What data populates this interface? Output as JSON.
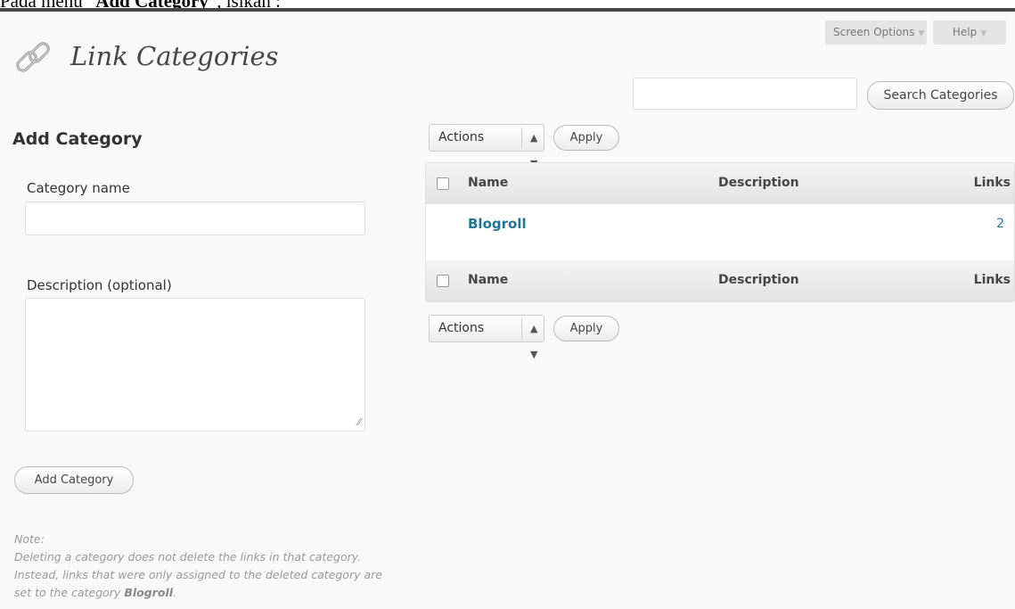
{
  "caption": {
    "prefix": "Pada menu “",
    "bold": "Add Category",
    "suffix": "”, isikan :"
  },
  "header": {
    "screen_options": "Screen Options",
    "help": "Help",
    "title": "Link Categories",
    "icon": "link-icon"
  },
  "search": {
    "input_value": "",
    "button_label": "Search Categories"
  },
  "add_form": {
    "heading": "Add Category",
    "name_label": "Category name",
    "name_value": "",
    "description_label": "Description (optional)",
    "description_value": "",
    "submit_label": "Add Category"
  },
  "note": {
    "title": "Note:",
    "text_before": "Deleting a category does not delete the links in that category. Instead, links that were only assigned to the deleted category are set to the category ",
    "bold": "Blogroll",
    "text_after": "."
  },
  "bulk_actions": {
    "select_value": "Actions",
    "apply_label": "Apply"
  },
  "table": {
    "columns": {
      "name": "Name",
      "description": "Description",
      "links": "Links"
    },
    "rows": [
      {
        "name": "Blogroll",
        "description": "",
        "links": "2"
      }
    ]
  },
  "colors": {
    "link": "#21759b",
    "panel_bg": "#f9f9f9",
    "topbar": "#464646"
  }
}
